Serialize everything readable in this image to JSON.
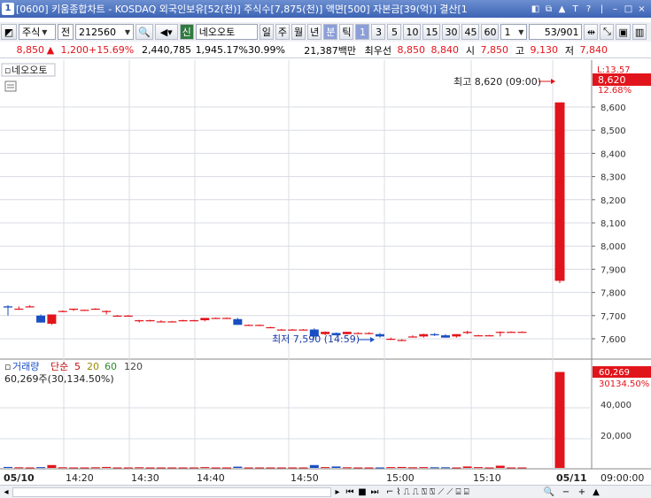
{
  "window": {
    "title": "[0600] 키움종합차트 - KOSDAQ 외국인보유[52(천)] 주식수[7,875(천)] 액면[500] 자본금[39(억)] 결산[1",
    "app_icon": "1",
    "title_buttons": [
      "◧",
      "⧉",
      "▲",
      "T",
      "?",
      "|",
      "–",
      "□",
      "×"
    ]
  },
  "toolbar": {
    "market": "주식",
    "market_alt": "전",
    "code": "212560",
    "stock_name": "네오오토",
    "stock_badge": "신",
    "periods": [
      "일",
      "주",
      "월",
      "년",
      "분",
      "틱"
    ],
    "active_period": "분",
    "intervals": [
      "1",
      "3",
      "5",
      "10",
      "15",
      "30",
      "45",
      "60"
    ],
    "active_interval": "1",
    "interval_select": "1",
    "count": "53",
    "total": "/901"
  },
  "quote": {
    "price": "8,850",
    "change_arrow": "▲",
    "change": "1,200",
    "change_pct": "+15.69%",
    "volume": "2,440,785",
    "volume_pct": "1,945.17%",
    "turnover": "30.99%",
    "amount": "21,387백만",
    "best_label": "최우선",
    "best_ask": "8,850",
    "best_bid": "8,840",
    "open_label": "시",
    "open": "7,850",
    "high_label": "고",
    "high": "9,130",
    "low_label": "저",
    "low": "7,840"
  },
  "chart": {
    "legend_name": "네오오토",
    "high_annotation": "최고 8,620 (09:00)",
    "low_annotation": "최저 7,590 (14:59)",
    "price_axis": [
      "8,600",
      "8,500",
      "8,400",
      "8,300",
      "8,200",
      "8,100",
      "8,000",
      "7,900",
      "7,800",
      "7,700",
      "7,600"
    ],
    "current_tag_top": "L:13.57",
    "current_price_tag": "8,620",
    "current_pct_tag": "12.68%",
    "volume_legend": {
      "name": "거래량",
      "type": "단순",
      "p1": "5",
      "p2": "20",
      "p3": "60",
      "p4": "120"
    },
    "volume_value": "60,269주(30,134.50%)",
    "volume_axis": [
      "40,000",
      "20,000"
    ],
    "volume_tag": "60,269",
    "volume_tag2": "30134.50%",
    "time_axis": [
      "05/10",
      "14:20",
      "14:30",
      "14:40",
      "14:50",
      "15:00",
      "15:10",
      "05/11",
      "09:00:00"
    ],
    "colors": {
      "up": "#e2141b",
      "down": "#1a4fc4",
      "grid": "#d8dce4"
    }
  },
  "chart_data": {
    "type": "candlestick",
    "title": "",
    "ylabel": "",
    "ylim": [
      7560,
      8650
    ],
    "candles": [
      {
        "t": "14:11",
        "o": 7740,
        "h": 7745,
        "l": 7700,
        "c": 7735
      },
      {
        "t": "14:12",
        "o": 7730,
        "h": 7740,
        "l": 7725,
        "c": 7730
      },
      {
        "t": "14:13",
        "o": 7740,
        "h": 7745,
        "l": 7735,
        "c": 7740
      },
      {
        "t": "14:14",
        "o": 7700,
        "h": 7705,
        "l": 7670,
        "c": 7670
      },
      {
        "t": "14:15",
        "o": 7665,
        "h": 7705,
        "l": 7660,
        "c": 7705
      },
      {
        "t": "14:16",
        "o": 7720,
        "h": 7722,
        "l": 7715,
        "c": 7720
      },
      {
        "t": "14:17",
        "o": 7725,
        "h": 7730,
        "l": 7720,
        "c": 7730
      },
      {
        "t": "14:18",
        "o": 7725,
        "h": 7725,
        "l": 7720,
        "c": 7725
      },
      {
        "t": "14:19",
        "o": 7730,
        "h": 7732,
        "l": 7725,
        "c": 7730
      },
      {
        "t": "14:20",
        "o": 7720,
        "h": 7722,
        "l": 7705,
        "c": 7720
      },
      {
        "t": "14:22",
        "o": 7700,
        "h": 7702,
        "l": 7695,
        "c": 7700
      },
      {
        "t": "14:23",
        "o": 7700,
        "h": 7702,
        "l": 7698,
        "c": 7700
      },
      {
        "t": "14:24",
        "o": 7680,
        "h": 7682,
        "l": 7670,
        "c": 7680
      },
      {
        "t": "14:25",
        "o": 7680,
        "h": 7682,
        "l": 7675,
        "c": 7680
      },
      {
        "t": "14:26",
        "o": 7675,
        "h": 7680,
        "l": 7672,
        "c": 7675
      },
      {
        "t": "14:27",
        "o": 7675,
        "h": 7677,
        "l": 7672,
        "c": 7675
      },
      {
        "t": "14:28",
        "o": 7680,
        "h": 7682,
        "l": 7675,
        "c": 7680
      },
      {
        "t": "14:29",
        "o": 7680,
        "h": 7682,
        "l": 7678,
        "c": 7680
      },
      {
        "t": "14:30",
        "o": 7680,
        "h": 7682,
        "l": 7675,
        "c": 7690
      },
      {
        "t": "14:31",
        "o": 7690,
        "h": 7692,
        "l": 7688,
        "c": 7690
      },
      {
        "t": "14:32",
        "o": 7690,
        "h": 7692,
        "l": 7688,
        "c": 7690
      },
      {
        "t": "14:33",
        "o": 7685,
        "h": 7690,
        "l": 7660,
        "c": 7660
      },
      {
        "t": "14:34",
        "o": 7660,
        "h": 7662,
        "l": 7658,
        "c": 7660
      },
      {
        "t": "14:35",
        "o": 7660,
        "h": 7662,
        "l": 7655,
        "c": 7660
      },
      {
        "t": "14:36",
        "o": 7650,
        "h": 7652,
        "l": 7648,
        "c": 7650
      },
      {
        "t": "14:37",
        "o": 7640,
        "h": 7642,
        "l": 7638,
        "c": 7640
      },
      {
        "t": "14:38",
        "o": 7640,
        "h": 7642,
        "l": 7638,
        "c": 7640
      },
      {
        "t": "14:39",
        "o": 7640,
        "h": 7642,
        "l": 7638,
        "c": 7640
      },
      {
        "t": "14:40",
        "o": 7640,
        "h": 7645,
        "l": 7605,
        "c": 7610
      },
      {
        "t": "14:41",
        "o": 7620,
        "h": 7632,
        "l": 7615,
        "c": 7630
      },
      {
        "t": "14:42",
        "o": 7625,
        "h": 7627,
        "l": 7615,
        "c": 7615
      },
      {
        "t": "14:43",
        "o": 7620,
        "h": 7630,
        "l": 7618,
        "c": 7630
      },
      {
        "t": "14:44",
        "o": 7625,
        "h": 7628,
        "l": 7620,
        "c": 7625
      },
      {
        "t": "14:45",
        "o": 7625,
        "h": 7628,
        "l": 7620,
        "c": 7625
      },
      {
        "t": "14:46",
        "o": 7620,
        "h": 7625,
        "l": 7605,
        "c": 7610
      },
      {
        "t": "14:47",
        "o": 7600,
        "h": 7605,
        "l": 7595,
        "c": 7600
      },
      {
        "t": "14:48",
        "o": 7595,
        "h": 7598,
        "l": 7590,
        "c": 7595
      },
      {
        "t": "14:49",
        "o": 7610,
        "h": 7615,
        "l": 7608,
        "c": 7610
      },
      {
        "t": "14:50",
        "o": 7610,
        "h": 7622,
        "l": 7605,
        "c": 7620
      },
      {
        "t": "14:51",
        "o": 7620,
        "h": 7625,
        "l": 7612,
        "c": 7615
      },
      {
        "t": "14:52",
        "o": 7615,
        "h": 7620,
        "l": 7605,
        "c": 7605
      },
      {
        "t": "14:53",
        "o": 7610,
        "h": 7620,
        "l": 7605,
        "c": 7620
      },
      {
        "t": "14:54",
        "o": 7625,
        "h": 7635,
        "l": 7620,
        "c": 7630
      },
      {
        "t": "14:55",
        "o": 7615,
        "h": 7617,
        "l": 7612,
        "c": 7615
      },
      {
        "t": "14:56",
        "o": 7615,
        "h": 7617,
        "l": 7612,
        "c": 7615
      },
      {
        "t": "14:57",
        "o": 7630,
        "h": 7632,
        "l": 7610,
        "c": 7630
      },
      {
        "t": "14:58",
        "o": 7630,
        "h": 7632,
        "l": 7628,
        "c": 7630
      },
      {
        "t": "14:59",
        "o": 7630,
        "h": 7632,
        "l": 7628,
        "c": 7630
      },
      {
        "t": "09:00",
        "o": 7850,
        "h": 8620,
        "l": 7840,
        "c": 8620
      }
    ],
    "volume": [
      600,
      400,
      300,
      500,
      1800,
      400,
      300,
      300,
      400,
      600,
      300,
      300,
      400,
      300,
      300,
      300,
      300,
      300,
      500,
      300,
      300,
      800,
      300,
      300,
      300,
      300,
      300,
      300,
      1800,
      500,
      900,
      400,
      300,
      300,
      300,
      500,
      600,
      400,
      500,
      400,
      400,
      300,
      900,
      500,
      300,
      1400,
      300,
      300,
      60269
    ]
  }
}
